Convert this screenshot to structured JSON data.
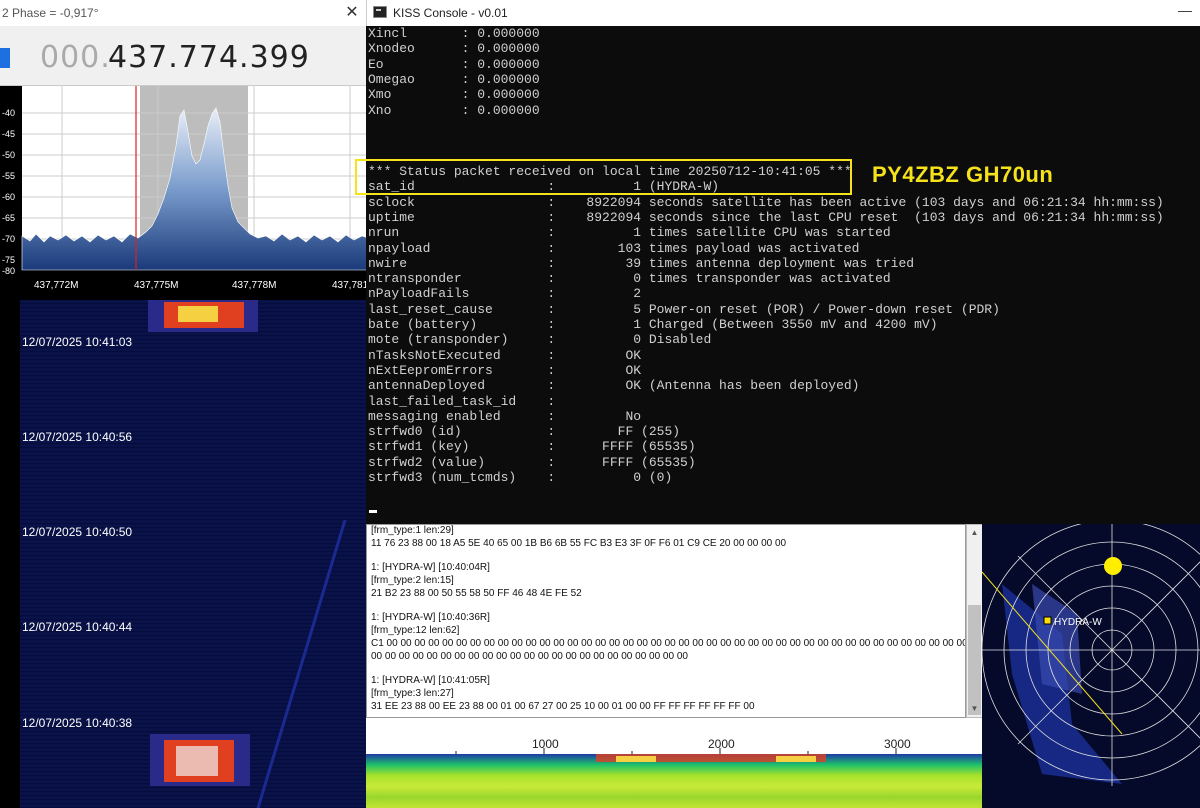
{
  "sdr": {
    "title": "2 Phase = -0,917°",
    "freq_dim": "000.",
    "freq_main": "437.774.399",
    "db_ticks": [
      "-40",
      "-45",
      "-50",
      "-55",
      "-60",
      "-65",
      "-70",
      "-75",
      "-80"
    ],
    "freq_ticks": [
      "437,772M",
      "437,775M",
      "437,778M",
      "437,781"
    ],
    "timestamps": [
      "12/07/2025 10:41:03",
      "12/07/2025 10:40:56",
      "12/07/2025 10:40:50",
      "12/07/2025 10:40:44",
      "12/07/2025 10:40:38"
    ]
  },
  "kiss": {
    "title": "KISS Console - v0.01",
    "minimize": "—",
    "lines": [
      "Xincl       : 0.000000",
      "Xnodeo      : 0.000000",
      "Eo          : 0.000000",
      "Omegao      : 0.000000",
      "Xmo         : 0.000000",
      "Xno         : 0.000000",
      "",
      "",
      "",
      "*** Status packet received on local time 20250712-10:41:05 ***",
      "sat_id                 :          1 (HYDRA-W)",
      "sclock                 :    8922094 seconds satellite has been active (103 days and 06:21:34 hh:mm:ss)",
      "uptime                 :    8922094 seconds since the last CPU reset  (103 days and 06:21:34 hh:mm:ss)",
      "nrun                   :          1 times satellite CPU was started",
      "npayload               :        103 times payload was activated",
      "nwire                  :         39 times antenna deployment was tried",
      "ntransponder           :          0 times transponder was activated",
      "nPayloadFails          :          2",
      "last_reset_cause       :          5 Power-on reset (POR) / Power-down reset (PDR)",
      "bate (battery)         :          1 Charged (Between 3550 mV and 4200 mV)",
      "mote (transponder)     :          0 Disabled",
      "nTasksNotExecuted      :         OK",
      "nExtEepromErrors       :         OK",
      "antennaDeployed        :         OK (Antenna has been deployed)",
      "last_failed_task_id    :",
      "messaging enabled      :         No",
      "strfwd0 (id)           :        FF (255)",
      "strfwd1 (key)          :      FFFF (65535)",
      "strfwd2 (value)        :      FFFF (65535)",
      "strfwd3 (num_tcmds)    :          0 (0)"
    ],
    "callsign": "PY4ZBZ  GH70un"
  },
  "packet_log": {
    "lines": [
      "[frm_type:1 len:29]",
      "11 76 23 88 00 18 A5 5E 40 65 00 1B B6 6B 55 FC B3 E3 3F 0F F6 01 C9 CE 20 00 00 00 00",
      "",
      "1: [HYDRA-W] [10:40:04R]",
      "[frm_type:2 len:15]",
      "21 B2 23 88 00 50 55 58 50 FF 46 48 4E FE 52",
      "",
      "1: [HYDRA-W] [10:40:36R]",
      "[frm_type:12 len:62]",
      "C1 00 00 00 00 00 00 00 00 00 00 00 00 00 00 00 00 00 00 00 00 00 00 00 00 00 00 00 00 00 00 00 00 00 00 00 00 00 00 00 00 00 00 00",
      "00 00 00 00 00 00 00 00 00 00 00 00 00 00 00 00 00 00 00 00 00 00 00",
      "",
      "1: [HYDRA-W] [10:41:05R]",
      "[frm_type:3 len:27]",
      "31 EE 23 88 00 EE 23 88 00 01 00 67 27 00 25 10 00 01 00 00 FF FF FF FF FF FF 00"
    ]
  },
  "audio_scale": [
    "1000",
    "2000",
    "3000"
  ],
  "polar": {
    "satellite_label": "HYDRA-W"
  },
  "colors": {
    "highlight": "#f5e21a",
    "console_bg": "#0c0c0c",
    "console_text": "#d0d0d0"
  }
}
